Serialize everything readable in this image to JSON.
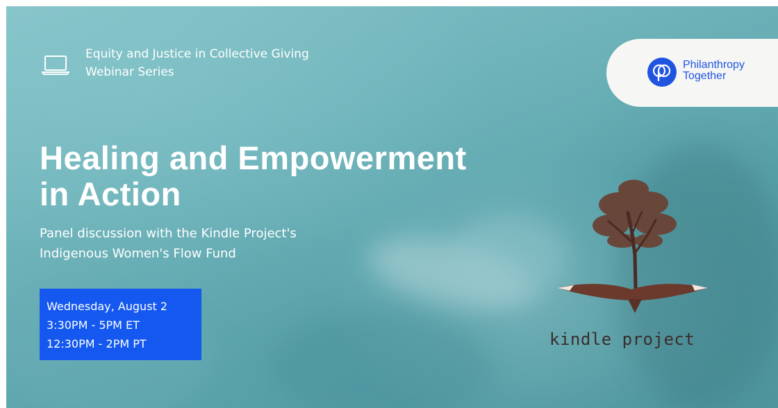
{
  "series": {
    "line1": "Equity and Justice in Collective Giving",
    "line2": "Webinar Series",
    "icon": "laptop-icon"
  },
  "logo": {
    "name_line1": "Philanthropy",
    "name_line2": "Together",
    "brand_color": "#1f54e0"
  },
  "headline": {
    "line1": "Healing and Empowerment",
    "line2": "in Action"
  },
  "subtitle": {
    "line1": "Panel discussion with the Kindle Project's",
    "line2": "Indigenous Women's Flow Fund"
  },
  "event": {
    "date": "Wednesday, August 2",
    "time_et": "3:30PM - 5PM ET",
    "time_pt": "12:30PM - 2PM PT",
    "box_color": "#1458f0"
  },
  "partner": {
    "wordmark": "kindle project",
    "icon": "tree-with-wings-icon"
  },
  "colors": {
    "background": "#6fb3ba",
    "text": "#ffffff"
  }
}
